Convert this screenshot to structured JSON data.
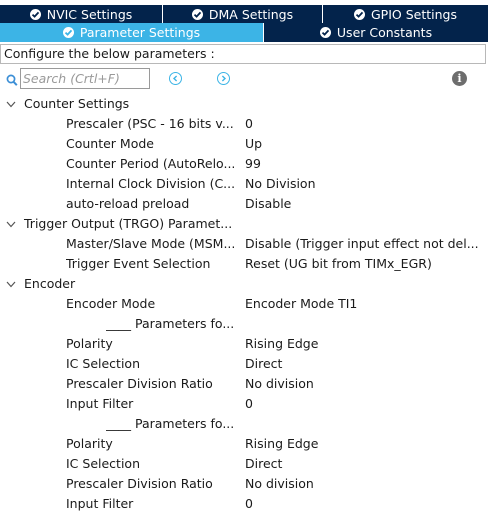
{
  "tabs_row1": [
    {
      "label": "NVIC Settings",
      "active": false
    },
    {
      "label": "DMA Settings",
      "active": false
    },
    {
      "label": "GPIO Settings",
      "active": false
    }
  ],
  "tabs_row2": [
    {
      "label": "Parameter Settings",
      "active": true
    },
    {
      "label": "User Constants",
      "active": false
    }
  ],
  "config_text": "Configure the below parameters :",
  "search": {
    "placeholder": "Search (Crtl+F)"
  },
  "info_label": "i",
  "groups": {
    "counter": "Counter Settings",
    "trgo": "Trigger Output (TRGO) Paramet...",
    "encoder": "Encoder"
  },
  "params": {
    "prescaler": {
      "name": "Prescaler (PSC - 16 bits v...",
      "value": "0"
    },
    "counter_mode": {
      "name": "Counter Mode",
      "value": "Up"
    },
    "counter_period": {
      "name": "Counter Period (AutoRelo...",
      "value": "99"
    },
    "clock_division": {
      "name": "Internal Clock Division (C...",
      "value": "No Division"
    },
    "auto_reload": {
      "name": "auto-reload preload",
      "value": "Disable"
    },
    "master_slave": {
      "name": "Master/Slave Mode (MSM...",
      "value": "Disable (Trigger input effect not del..."
    },
    "trigger_event": {
      "name": "Trigger Event Selection",
      "value": "Reset (UG bit from TIMx_EGR)"
    },
    "encoder_mode": {
      "name": "Encoder Mode",
      "value": "Encoder Mode TI1"
    },
    "ch1_header": {
      "name": "____ Parameters fo..."
    },
    "ch1_polarity": {
      "name": "Polarity",
      "value": "Rising Edge"
    },
    "ch1_ic_selection": {
      "name": "IC Selection",
      "value": "Direct"
    },
    "ch1_prescaler": {
      "name": "Prescaler Division Ratio",
      "value": "No division"
    },
    "ch1_filter": {
      "name": "Input Filter",
      "value": "0"
    },
    "ch2_header": {
      "name": "____ Parameters fo..."
    },
    "ch2_polarity": {
      "name": "Polarity",
      "value": "Rising Edge"
    },
    "ch2_ic_selection": {
      "name": "IC Selection",
      "value": "Direct"
    },
    "ch2_prescaler": {
      "name": "Prescaler Division Ratio",
      "value": "No division"
    },
    "ch2_filter": {
      "name": "Input Filter",
      "value": "0"
    }
  },
  "colors": {
    "tab_dark": "#03234b",
    "tab_active": "#3cb4e6",
    "accent": "#3cb4e6"
  }
}
